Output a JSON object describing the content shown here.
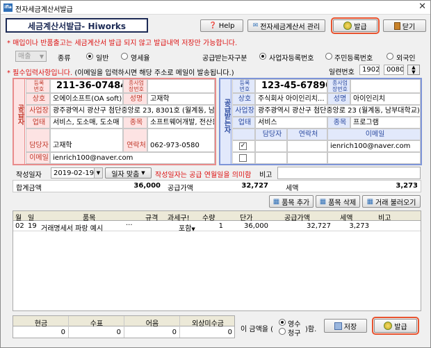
{
  "window": {
    "title": "전자세금계산서발급",
    "app_icon": "ifla",
    "close_glyph": "✕"
  },
  "header": {
    "form_title": "세금계산서발급- Hiworks",
    "help_label": "Help",
    "manage_label": "전자세금계산서 관리",
    "issue_label": "발급",
    "close_label": "닫기"
  },
  "notices": {
    "top": "* 매입이나 반품출고는 세금계산서 발급 되지 않고 발급내역 저장만 가능합니다.",
    "required": "* 필수입력사항입니다.",
    "required_tail": "(이메일을 입력하시면 해당 주소로 메일이 발송됩니다.)"
  },
  "type_row": {
    "sale_select": "매출",
    "kind_label": "종류",
    "kind_options": [
      "일반",
      "영세율"
    ],
    "kind_selected": 0,
    "receiver_type_label": "공급받는자구분",
    "receiver_options": [
      "사업자등록번호",
      "주민등록번호",
      "외국인"
    ],
    "receiver_selected": 0,
    "serial_label": "일련번호",
    "serial_1": "1902",
    "serial_2": "0080"
  },
  "supplier": {
    "side_label": "공급자",
    "reg_label": "등록\n번호",
    "reg_no": "211-36-07484",
    "sub_label": "종사업\n장번호",
    "sub_no": "",
    "company_label": "상호",
    "company": "오에이소프트(OA soft)",
    "name_label": "성명",
    "name": "고재학",
    "address_label": "사업장",
    "address": "광주광역시 광산구 첨단중앙로 23, 8301호 (월계동, 남부대",
    "biz_type_label": "업태",
    "biz_type": "서비스, 도소매, 도소매",
    "biz_item_label": "종목",
    "biz_item": "소프트웨어개발, 전산용",
    "manager_label": "담당자",
    "manager": "고재학",
    "contact_label": "연락처",
    "contact": "062-973-0580",
    "email_label": "이메일",
    "email": "ienrich100@naver.com"
  },
  "receiver": {
    "side_label": "공급받는자",
    "reg_label": "등록\n번호",
    "reg_no": "123-45-67890",
    "sub_label": "종사업\n장번호",
    "sub_no": "",
    "company_label": "상호",
    "company": "주식회사 아이인리치...",
    "name_label": "성명",
    "name": "아이인리치",
    "address_label": "사업장",
    "address": "광주광역시 광산구 첨단중앙로 23 (월계동, 남부대학교)",
    "biz_type_label": "업태",
    "biz_type": "서비스",
    "biz_item_label": "종목",
    "biz_item": "프로그램",
    "contact_headers": [
      "담당자",
      "연락처",
      "이메일"
    ],
    "contacts": [
      {
        "checked": true,
        "manager": "",
        "phone": "",
        "email": "ienrich100@naver.com"
      },
      {
        "checked": false,
        "manager": "",
        "phone": "",
        "email": ""
      }
    ]
  },
  "date_row": {
    "date_label": "작성일자",
    "date": "2019-02-19",
    "match_label": "일자 맞춤",
    "date_note": "작성일자는 공급 연월일을 의미함",
    "memo_label": "비고",
    "memo": ""
  },
  "totals": {
    "total_label": "합계금액",
    "total": "36,000",
    "supply_label": "공급가액",
    "supply": "32,727",
    "tax_label": "세액",
    "tax": "3,273"
  },
  "item_buttons": {
    "add": "품목 추가",
    "delete": "품목 삭제",
    "load": "거래 불러오기"
  },
  "items_table": {
    "headers": [
      "월",
      "일",
      "품목",
      "규격",
      "과세구!",
      "수량",
      "단가",
      "공급가액",
      "세액",
      "비고"
    ],
    "rows": [
      [
        "02",
        "19",
        "거래명세서 파랑 예시",
        "",
        "포함",
        "1",
        "36,000",
        "32,727",
        "3,273",
        ""
      ]
    ],
    "more_glyph": "···"
  },
  "payment": {
    "headers": [
      "현금",
      "수표",
      "어음",
      "외상미수금"
    ],
    "values": [
      "0",
      "0",
      "0",
      "0"
    ],
    "amount_prefix": "이 금액을 (",
    "options": [
      "영수",
      "청구"
    ],
    "selected": 0,
    "amount_suffix": ")함.",
    "save_label": "저장",
    "issue_label": "발급"
  }
}
